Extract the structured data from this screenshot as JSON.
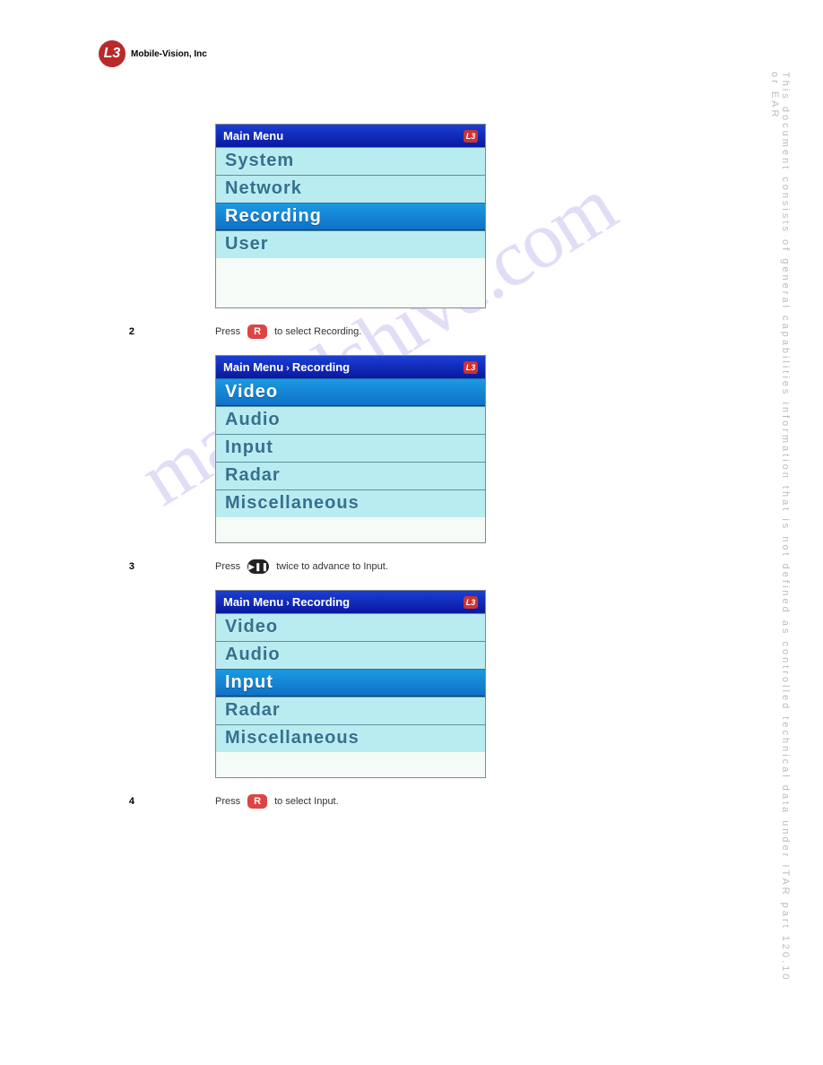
{
  "logo": {
    "mark": "L3",
    "company": "Mobile-Vision, Inc"
  },
  "watermark": "manualshive.com",
  "side_notice": "This document consists of general capabilities information that is not defined as controlled technical data under  ITAR part 120.10 or EAR",
  "screens": [
    {
      "header": "Main Menu",
      "items": [
        "System",
        "Network",
        "Recording",
        "User"
      ],
      "selected_index": 2,
      "spacer": "large"
    },
    {
      "header_parts": [
        "Main Menu",
        "Recording"
      ],
      "items": [
        "Video",
        "Audio",
        "Input",
        "Radar",
        "Miscellaneous"
      ],
      "selected_index": 0,
      "spacer": "small"
    },
    {
      "header_parts": [
        "Main Menu",
        "Recording"
      ],
      "items": [
        "Video",
        "Audio",
        "Input",
        "Radar",
        "Miscellaneous"
      ],
      "selected_index": 2,
      "spacer": "small"
    }
  ],
  "steps": [
    {
      "num": "2",
      "btn": "R",
      "btn_type": "r",
      "text": "to select Recording."
    },
    {
      "num": "3",
      "btn": "▶❚❚",
      "btn_type": "play",
      "text": "twice to advance to Input."
    },
    {
      "num": "4",
      "btn": "R",
      "btn_type": "r",
      "text": "to select Input."
    }
  ],
  "step_prefix": "Press",
  "footer": ""
}
